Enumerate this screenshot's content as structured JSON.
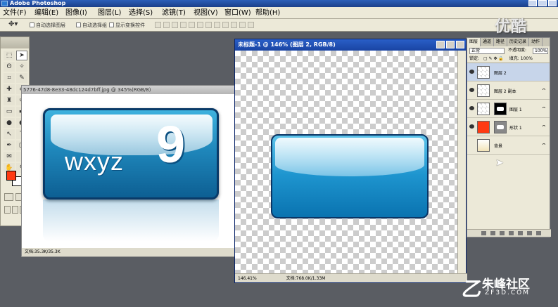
{
  "app": {
    "title": "Adobe Photoshop"
  },
  "menus": [
    "文件(F)",
    "编辑(E)",
    "图像(I)",
    "图层(L)",
    "选择(S)",
    "滤镜(T)",
    "视图(V)",
    "窗口(W)",
    "帮助(H)"
  ],
  "options": {
    "auto_select_layer": "自动选择图层",
    "auto_select_group": "自动选择组",
    "show_transform": "显示变换控件"
  },
  "watermark_top": "优酷",
  "doc1": {
    "title": "5776-47d8-8e33-48dc124d7bff.jpg @ 345%(RGB/8)",
    "label_letters": "wxyz",
    "label_number": "9",
    "status": "文档:35.3K/35.3K"
  },
  "doc2": {
    "title": "未标题-1 @ 146% (图层 2, RGB/8)",
    "zoom": "146.41%",
    "status": "文档:768.0K/1.33M"
  },
  "layers": {
    "tabs": [
      "图层",
      "通道",
      "路径",
      "历史记录",
      "动作"
    ],
    "blend_mode": "正常",
    "opacity_label": "不透明度:",
    "opacity_value": "100%",
    "lock_label": "锁定:",
    "fill_label": "填充:",
    "fill_value": "100%",
    "items": [
      {
        "name": "图层 2",
        "selected": true
      },
      {
        "name": "图层 2 副本",
        "selected": false
      },
      {
        "name": "图层 1",
        "selected": false
      },
      {
        "name": "形状 1",
        "selected": false
      },
      {
        "name": "背景",
        "selected": false
      }
    ]
  },
  "colors": {
    "foreground": "#ff3a12",
    "background": "#ffffff",
    "accent_blue": "#1e95cf"
  },
  "watermark_bottom": {
    "logo": "乙",
    "name": "朱峰社区",
    "url": "ZF3D.COM"
  }
}
